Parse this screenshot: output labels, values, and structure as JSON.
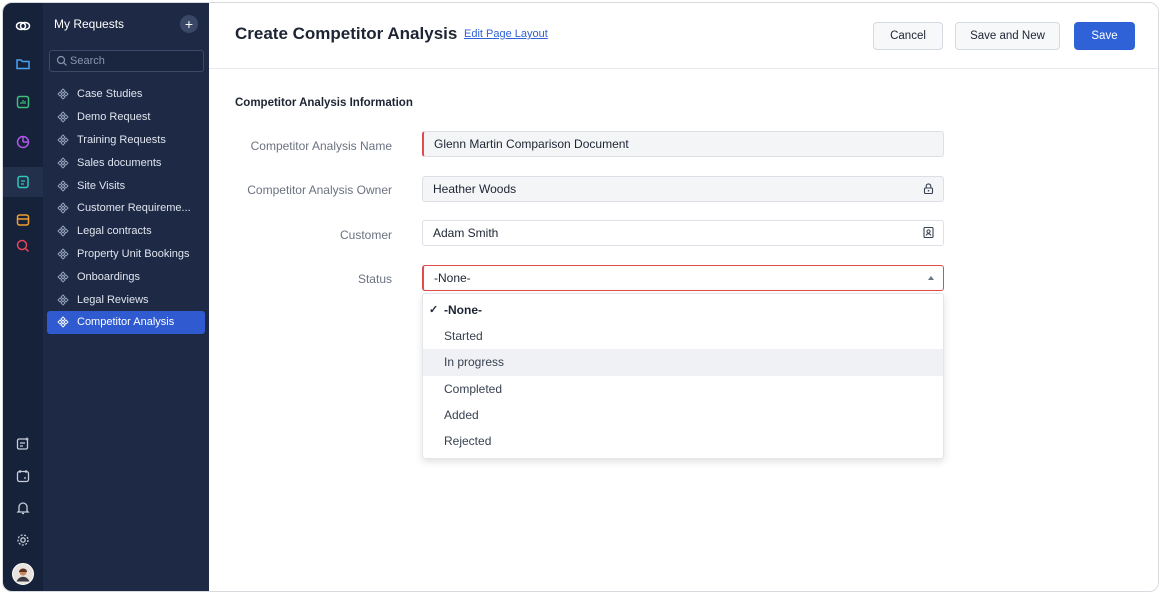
{
  "sidebar": {
    "title": "My Requests",
    "add_label": "+",
    "search_placeholder": "Search",
    "items": [
      {
        "label": "Case Studies"
      },
      {
        "label": "Demo Request"
      },
      {
        "label": "Training Requests"
      },
      {
        "label": "Sales documents"
      },
      {
        "label": "Site Visits"
      },
      {
        "label": "Customer Requireme..."
      },
      {
        "label": "Legal contracts"
      },
      {
        "label": "Property Unit Bookings"
      },
      {
        "label": "Onboardings"
      },
      {
        "label": "Legal Reviews"
      },
      {
        "label": "Competitor Analysis"
      }
    ],
    "active_item": "Competitor Analysis"
  },
  "header": {
    "title": "Create Competitor Analysis",
    "edit_layout_link": "Edit Page Layout",
    "cancel_label": "Cancel",
    "save_new_label": "Save and New",
    "save_label": "Save"
  },
  "form": {
    "section_title": "Competitor Analysis Information",
    "name_label": "Competitor Analysis Name",
    "name_value": "Glenn Martin Comparison Document",
    "owner_label": "Competitor Analysis Owner",
    "owner_value": "Heather Woods",
    "customer_label": "Customer",
    "customer_value": "Adam Smith",
    "status_label": "Status",
    "status_value": "-None-"
  },
  "status_dropdown": {
    "check_mark": "✓",
    "options": [
      {
        "label": "-None-"
      },
      {
        "label": "Started"
      },
      {
        "label": "In progress"
      },
      {
        "label": "Completed"
      },
      {
        "label": "Added"
      },
      {
        "label": "Rejected"
      }
    ],
    "selected": "-None-",
    "hovered": "In progress"
  },
  "colors": {
    "rail_bg": "#16213a",
    "sidebar_bg": "#1e2a45",
    "active_item": "#2f5ad0",
    "primary_button": "#2f62d6",
    "mandatory_marker": "#e04b4b"
  }
}
